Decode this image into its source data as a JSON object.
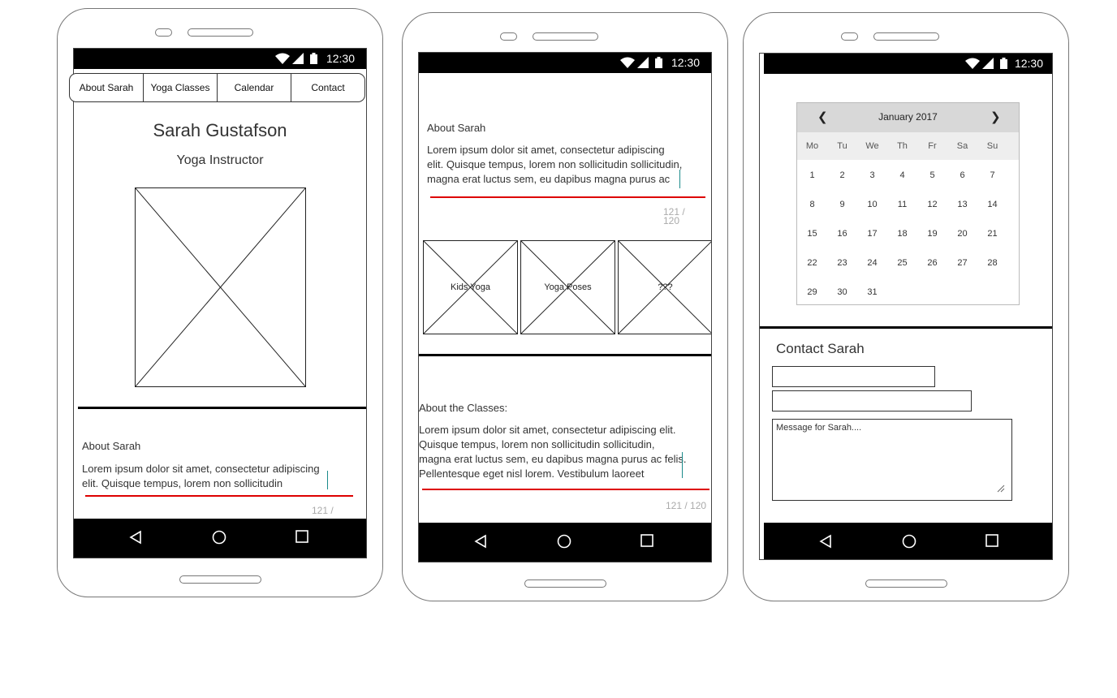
{
  "status": {
    "time": "12:30"
  },
  "screen1": {
    "tabs": [
      "About Sarah",
      "Yoga Classes",
      "Calendar",
      "Contact"
    ],
    "name": "Sarah Gustafson",
    "role": "Yoga Instructor",
    "about_label": "About Sarah",
    "about_lines": [
      "Lorem ipsum dolor sit amet, consectetur adipiscing",
      "elit. Quisque tempus, lorem non sollicitudin"
    ],
    "counter": "121 /"
  },
  "screen2": {
    "about_label": "About Sarah",
    "about_lines": [
      "Lorem ipsum dolor sit amet, consectetur adipiscing",
      "elit. Quisque tempus, lorem non sollicitudin sollicitudin,",
      "magna erat luctus sem, eu dapibus magna purus ac"
    ],
    "counter_top": "121 /",
    "counter_bottom": "120",
    "tiles": [
      "Kids Yoga",
      "Yoga Poses",
      "???"
    ],
    "classes_label": "About the Classes:",
    "classes_lines": [
      "Lorem ipsum dolor sit amet, consectetur adipiscing elit.",
      "Quisque tempus, lorem non sollicitudin sollicitudin,",
      "magna erat luctus sem, eu dapibus magna purus ac felis.",
      "Pellentesque eget nisl lorem. Vestibulum laoreet"
    ],
    "classes_counter": "121 / 120"
  },
  "screen3": {
    "calendar": {
      "title": "January 2017",
      "prev": "❮",
      "next": "❯",
      "dows": [
        "Mo",
        "Tu",
        "We",
        "Th",
        "Fr",
        "Sa",
        "Su"
      ],
      "weeks": [
        [
          "1",
          "2",
          "3",
          "4",
          "5",
          "6",
          "7"
        ],
        [
          "8",
          "9",
          "10",
          "11",
          "12",
          "13",
          "14"
        ],
        [
          "15",
          "16",
          "17",
          "18",
          "19",
          "20",
          "21"
        ],
        [
          "22",
          "23",
          "24",
          "25",
          "26",
          "27",
          "28"
        ],
        [
          "29",
          "30",
          "31"
        ]
      ]
    },
    "contact_title": "Contact Sarah",
    "message_placeholder": "Message for Sarah...."
  }
}
